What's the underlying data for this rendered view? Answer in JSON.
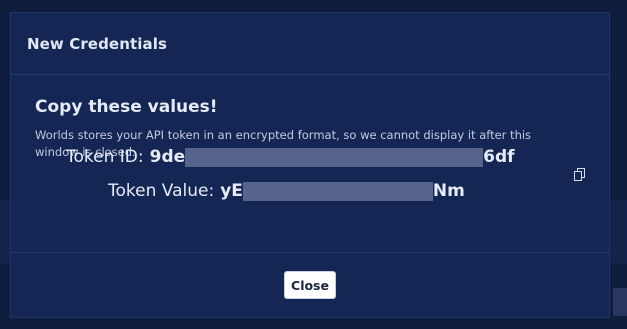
{
  "modal": {
    "title": "New Credentials",
    "heading": "Copy these values!",
    "description": "Worlds stores your API token in an encrypted format, so we cannot display it after this window is closed.",
    "token_id": {
      "label": "Token ID:",
      "prefix": "9de",
      "suffix": "6df"
    },
    "token_value": {
      "label": "Token Value:",
      "prefix": "yE",
      "suffix": "Nm"
    },
    "copy_icon": "copy-icon",
    "close_label": "Close"
  },
  "colors": {
    "backdrop": "#0f1d3e",
    "modal_bg": "#142654",
    "text": "#e6ebf6",
    "mask": "#56648c",
    "button_bg": "#ffffff"
  }
}
